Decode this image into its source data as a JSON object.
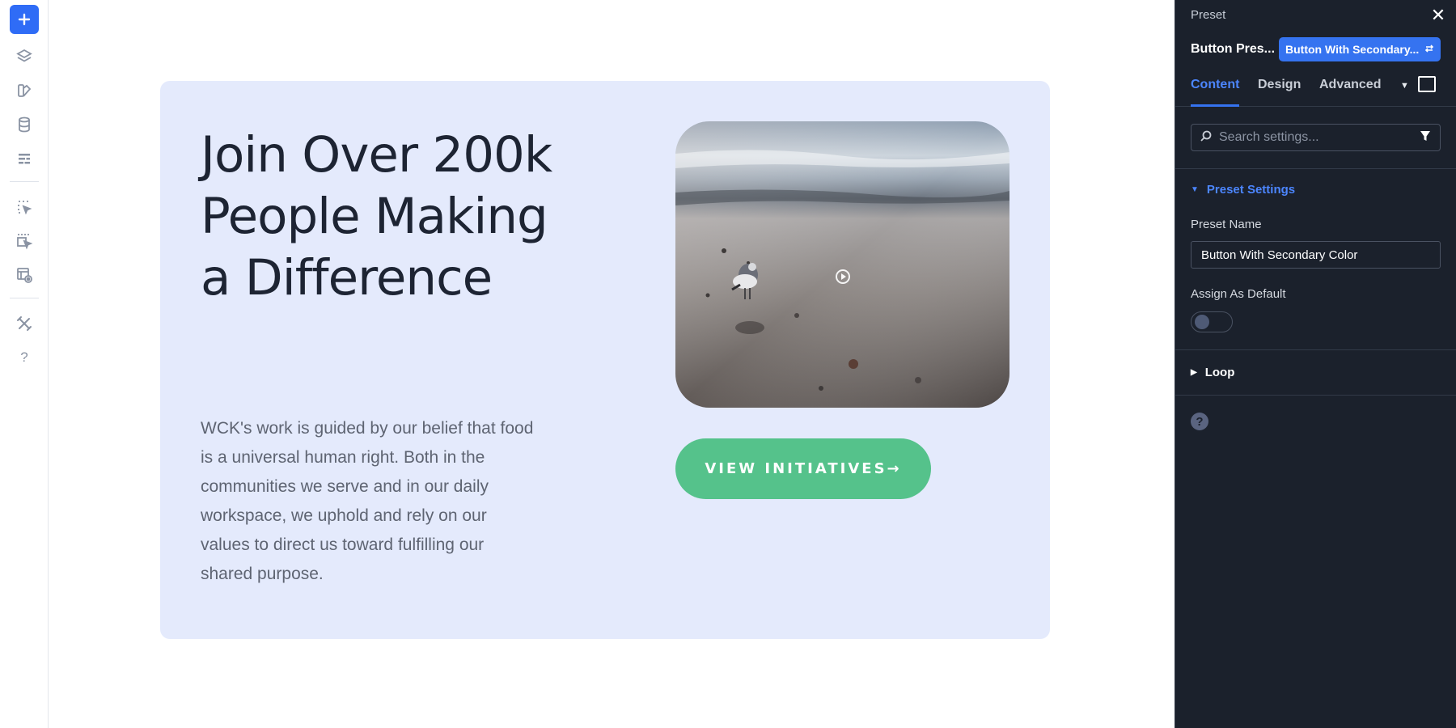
{
  "rail": {
    "icons": [
      "plus-icon",
      "layers-icon",
      "palette-icon",
      "database-icon",
      "layout-icon",
      "select-cursor-icon",
      "multi-select-icon",
      "preview-icon",
      "tools-icon",
      "help-icon"
    ],
    "help_glyph": "?"
  },
  "section": {
    "headline": "Join Over 200k People Making a Difference",
    "body": "WCK's work is guided by our belief that food is a universal human right. Both in the communities we serve and in our daily workspace, we uphold and rely on our values to direct us toward fulfilling our shared purpose.",
    "cta_label": "VIEW INITIATIVES→",
    "background_color": "#e4eafc",
    "cta_color": "#55c28b"
  },
  "panel": {
    "title": "Preset",
    "close_glyph": "✕",
    "preset_label": "Button Pres...",
    "preset_selected": "Button With Secondary...",
    "tabs": [
      {
        "label": "Content",
        "active": true
      },
      {
        "label": "Design",
        "active": false
      },
      {
        "label": "Advanced",
        "active": false
      }
    ],
    "search_placeholder": "Search settings...",
    "groups": {
      "preset_settings": "Preset Settings",
      "loop": "Loop"
    },
    "fields": {
      "preset_name_label": "Preset Name",
      "preset_name_value": "Button With Secondary Color",
      "assign_default_label": "Assign As Default",
      "assign_default_on": false
    },
    "help_glyph": "?",
    "accent_color": "#3573f0"
  }
}
